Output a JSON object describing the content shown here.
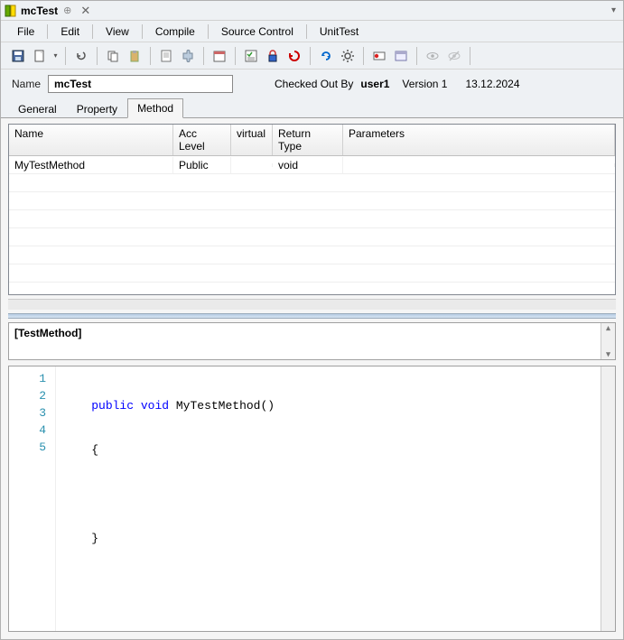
{
  "titlebar": {
    "title": "mcTest"
  },
  "menu": {
    "file": "File",
    "edit": "Edit",
    "view": "View",
    "compile": "Compile",
    "source_control": "Source Control",
    "unittest": "UnitTest"
  },
  "info": {
    "name_label": "Name",
    "name_value": "mcTest",
    "checked_out_label": "Checked Out By",
    "checked_out_user": "user1",
    "version_label": "Version 1",
    "date": "13.12.2024"
  },
  "tabs": {
    "general": "General",
    "property": "Property",
    "method": "Method"
  },
  "grid": {
    "headers": {
      "name": "Name",
      "acc": "Acc Level",
      "virtual": "virtual",
      "ret": "Return Type",
      "params": "Parameters"
    },
    "rows": [
      {
        "name": "MyTestMethod",
        "acc": "Public",
        "virtual": "",
        "ret": "void",
        "params": ""
      }
    ]
  },
  "attribute_box": "[TestMethod]",
  "code": {
    "lines": [
      {
        "n": "1",
        "pre": "    ",
        "kw1": "public",
        "sp1": " ",
        "kw2": "void",
        "rest": " MyTestMethod()"
      },
      {
        "n": "2",
        "pre": "    ",
        "rest": "{"
      },
      {
        "n": "3",
        "pre": "",
        "rest": ""
      },
      {
        "n": "4",
        "pre": "    ",
        "rest": "}"
      },
      {
        "n": "5",
        "pre": "",
        "rest": ""
      }
    ]
  }
}
